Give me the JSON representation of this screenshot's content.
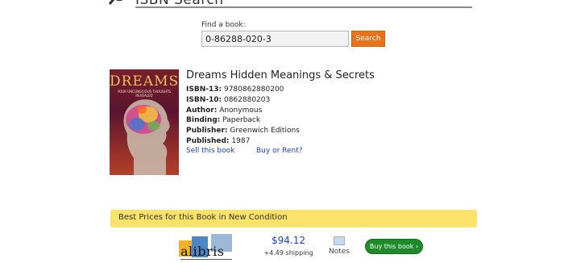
{
  "header": {
    "title": "ISBN Search",
    "icon": "magnifier-icon"
  },
  "search": {
    "label": "Find a book:",
    "value": "0-86288-020-3",
    "button_label": "Search"
  },
  "book": {
    "title": "Dreams Hidden Meanings & Secrets",
    "cover_title": "DREAMS",
    "cover_subtitle": "YOUR UNCONSCIOUS THOUGHTS REVEALED",
    "details": [
      {
        "label": "ISBN-13:",
        "value": "9780862880200"
      },
      {
        "label": "ISBN-10:",
        "value": "0862880203"
      },
      {
        "label": "Author:",
        "value": "Anonymous"
      },
      {
        "label": "Binding:",
        "value": "Paperback"
      },
      {
        "label": "Publisher:",
        "value": "Greenwich Editions"
      },
      {
        "label": "Published:",
        "value": "1987"
      }
    ],
    "sell_link": "Sell this book",
    "buy_rent_link": "Buy or Rent?"
  },
  "prices": {
    "heading": "Best Prices for this Book in New Condition",
    "offers": [
      {
        "seller": "alibris",
        "price": "$94.12",
        "shipping": "+4.49 shipping",
        "notes_label": "Notes",
        "buy_label": "Buy this book ›"
      }
    ]
  },
  "colors": {
    "accent_orange": "#e8731c",
    "price_bar": "#fbe26a",
    "link_blue": "#1a3fd0",
    "buy_green": "#1f8a2a"
  }
}
